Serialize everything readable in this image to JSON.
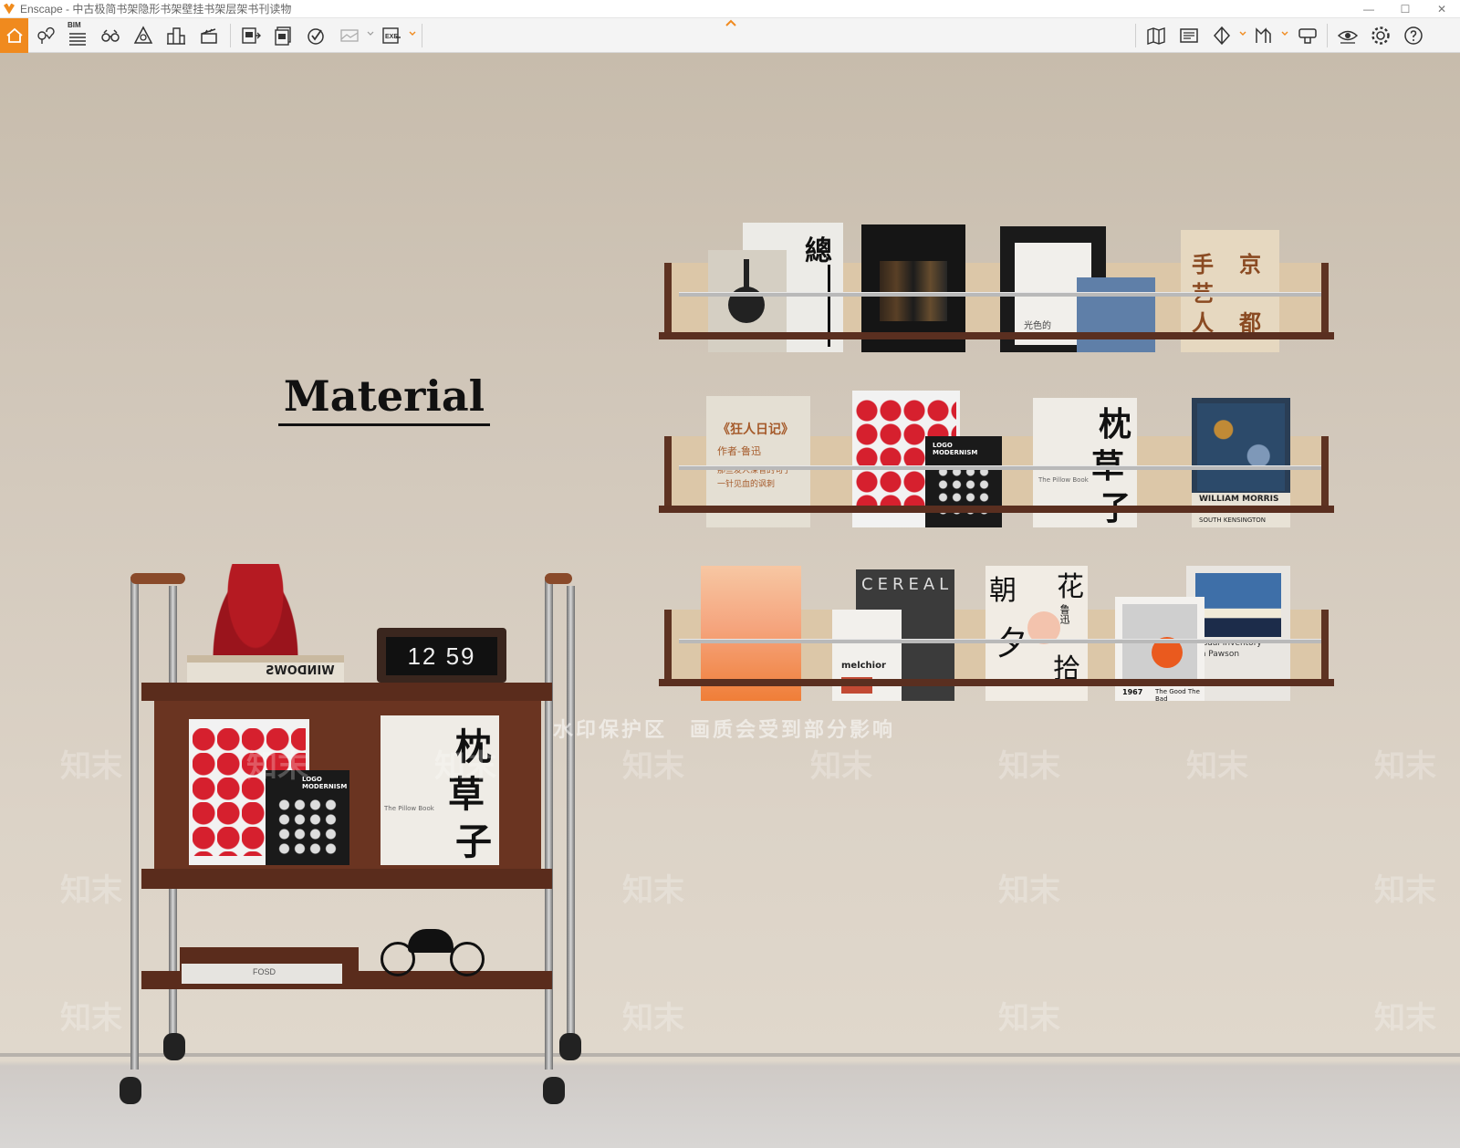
{
  "window": {
    "title": "Enscape - 中古极简书架隐形书架壁挂书架层架书刊读物",
    "minimize": "—",
    "maximize": "☐",
    "close": "✕"
  },
  "toolbar": {
    "bim_label": "BIM",
    "icons_left": [
      "home-icon",
      "location-icon",
      "bim-icon",
      "binoculars-icon",
      "atmosphere-icon",
      "buildings-icon",
      "clapper-icon",
      "screenshot-icon",
      "batch-render-icon",
      "vr-icon",
      "panorama-icon",
      "exe-export-icon"
    ],
    "icons_right": [
      "map-icon",
      "assets-icon",
      "materials-icon",
      "views-icon",
      "capture-icon",
      "visual-settings-icon",
      "settings-icon",
      "help-icon"
    ]
  },
  "scene": {
    "heading": "Material",
    "watermark_banner": "水印保护区　画质会受到部分影响",
    "watermark_tile": "知末",
    "clock": "12 59",
    "books": {
      "b1_title": "總",
      "b2_text": "光色的",
      "b3_title_a": "手",
      "b3_title_b": "京",
      "b3_title_c": "艺",
      "b3_title_d": "都",
      "b3_title_e": "人",
      "b4_title": "《狂人日记》",
      "b4_author": "作者-鲁迅",
      "b4_line1": "那些发人深省的句子",
      "b4_line2": "一针见血的讽刺",
      "b5_title": "LOGO MODERNISM",
      "b6_title_a": "枕",
      "b6_title_b": "草",
      "b6_title_c": "子",
      "b6_sub": "The Pillow Book",
      "b7_title": "WILLIAM MORRIS",
      "b7_sub": "SOUTH KENSINGTON",
      "b8_title": "CEREAL",
      "b9_title": "melchior",
      "b10_title_a": "朝",
      "b10_title_b": "花",
      "b10_title_c": "夕",
      "b10_title_d": "拾",
      "b10_author": "鲁迅",
      "b11_title": "Visual Inventory",
      "b11_sub": "hn Pawson",
      "b12_title": "1967",
      "b12_sub": "The Good The Bad",
      "b13_title": "WINDOWS",
      "b14_title": "LOGO MODERNISM",
      "b15_sub": "The Pillow Book",
      "speaker_label": "FOSD"
    }
  },
  "colors": {
    "accent": "#f08a1e",
    "wall": "#d2c8bb",
    "wood": "#5a2c1c",
    "red": "#d6202e"
  }
}
